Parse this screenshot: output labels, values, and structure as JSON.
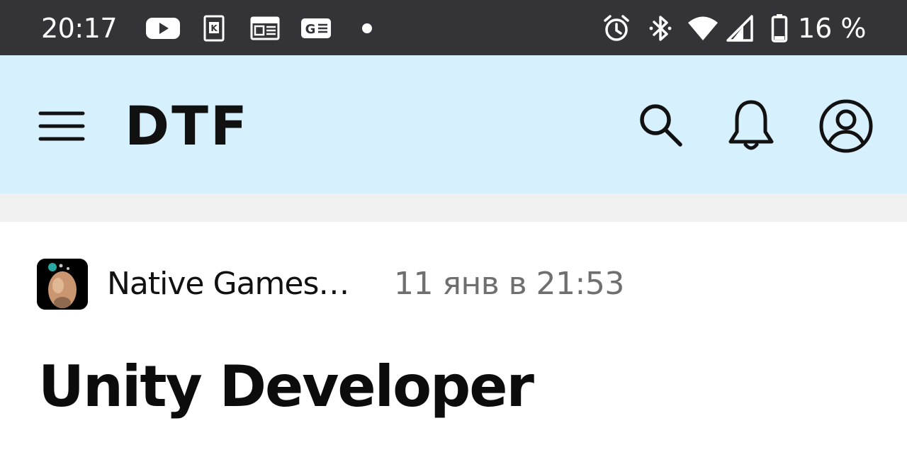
{
  "status_bar": {
    "time": "20:17",
    "battery_percent": "16 %",
    "notification_icons": [
      "youtube-icon",
      "kinopoisk-icon",
      "news-icon",
      "google-news-icon",
      "more-dot-icon"
    ],
    "system_icons": [
      "alarm-icon",
      "bluetooth-icon",
      "wifi-icon",
      "signal-icon",
      "battery-icon"
    ]
  },
  "header": {
    "logo": "DTF",
    "background_color": "#d6f1fd",
    "icons": [
      "menu-icon",
      "search-icon",
      "bell-icon",
      "account-icon"
    ]
  },
  "post": {
    "author": "Native Games…",
    "date": "11 янв в 21:53",
    "title": "Unity Developer"
  }
}
